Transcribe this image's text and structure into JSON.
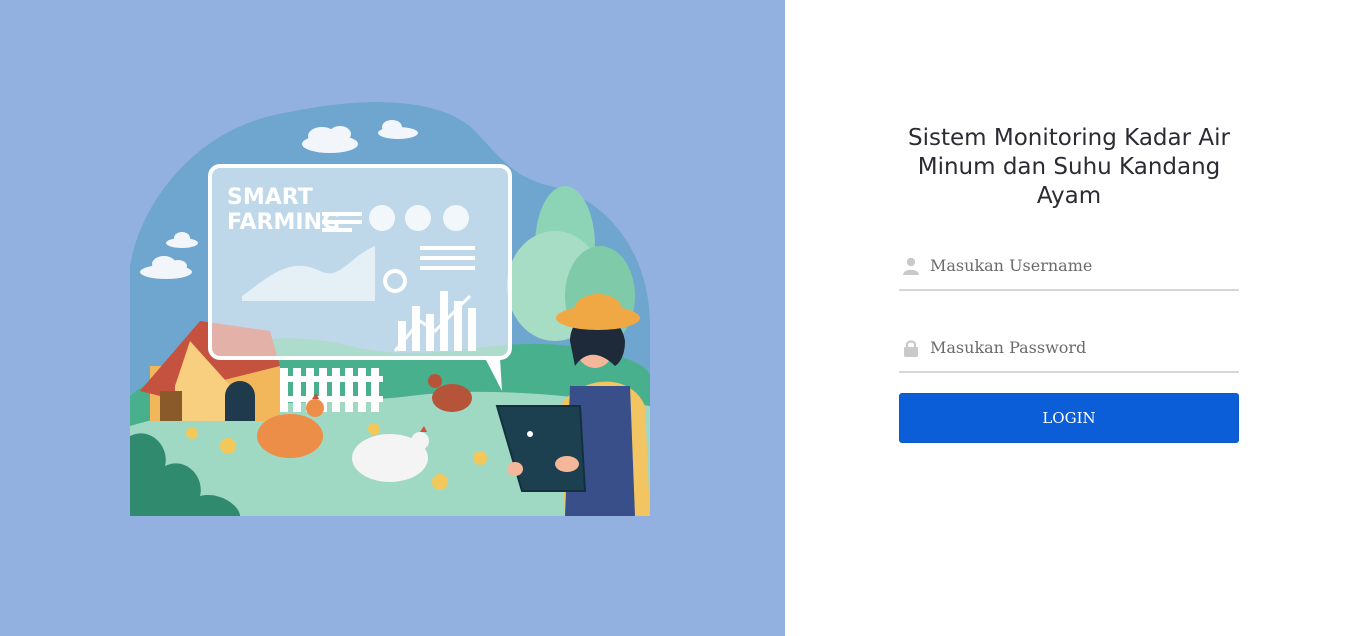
{
  "illustration": {
    "board_text_line1": "SMART",
    "board_text_line2": "FARMING"
  },
  "login": {
    "title": "Sistem Monitoring Kadar Air Minum dan Suhu Kandang Ayam",
    "username_placeholder": "Masukan Username",
    "password_placeholder": "Masukan Password",
    "login_label": "LOGIN",
    "user_icon": "user-icon",
    "lock_icon": "lock-icon"
  },
  "colors": {
    "left_panel": "#92b1e0",
    "button": "#0b5ed7",
    "underline": "#d6d6d6"
  }
}
